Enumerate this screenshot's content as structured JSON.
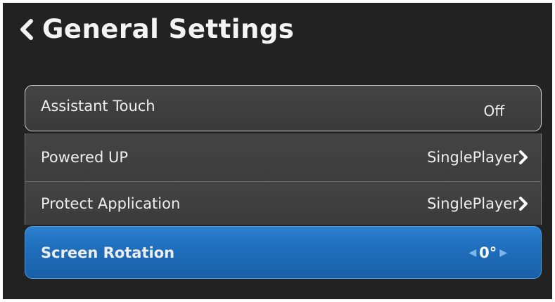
{
  "header": {
    "title": "General Settings"
  },
  "settings": [
    {
      "label": "Assistant Touch",
      "value": "Off"
    },
    {
      "label": "Powered UP",
      "value": "SinglePlayer"
    },
    {
      "label": "Protect Application",
      "value": "SinglePlayer"
    },
    {
      "label": "Screen Rotation",
      "value": "0°"
    }
  ],
  "colors": {
    "background": "#222222",
    "selected": "#1f6fbd",
    "row": "#404040"
  },
  "icons": {
    "back": "chevron-left-icon",
    "next": "chevron-right-icon",
    "decrease": "arrow-left-icon",
    "increase": "arrow-right-icon"
  }
}
